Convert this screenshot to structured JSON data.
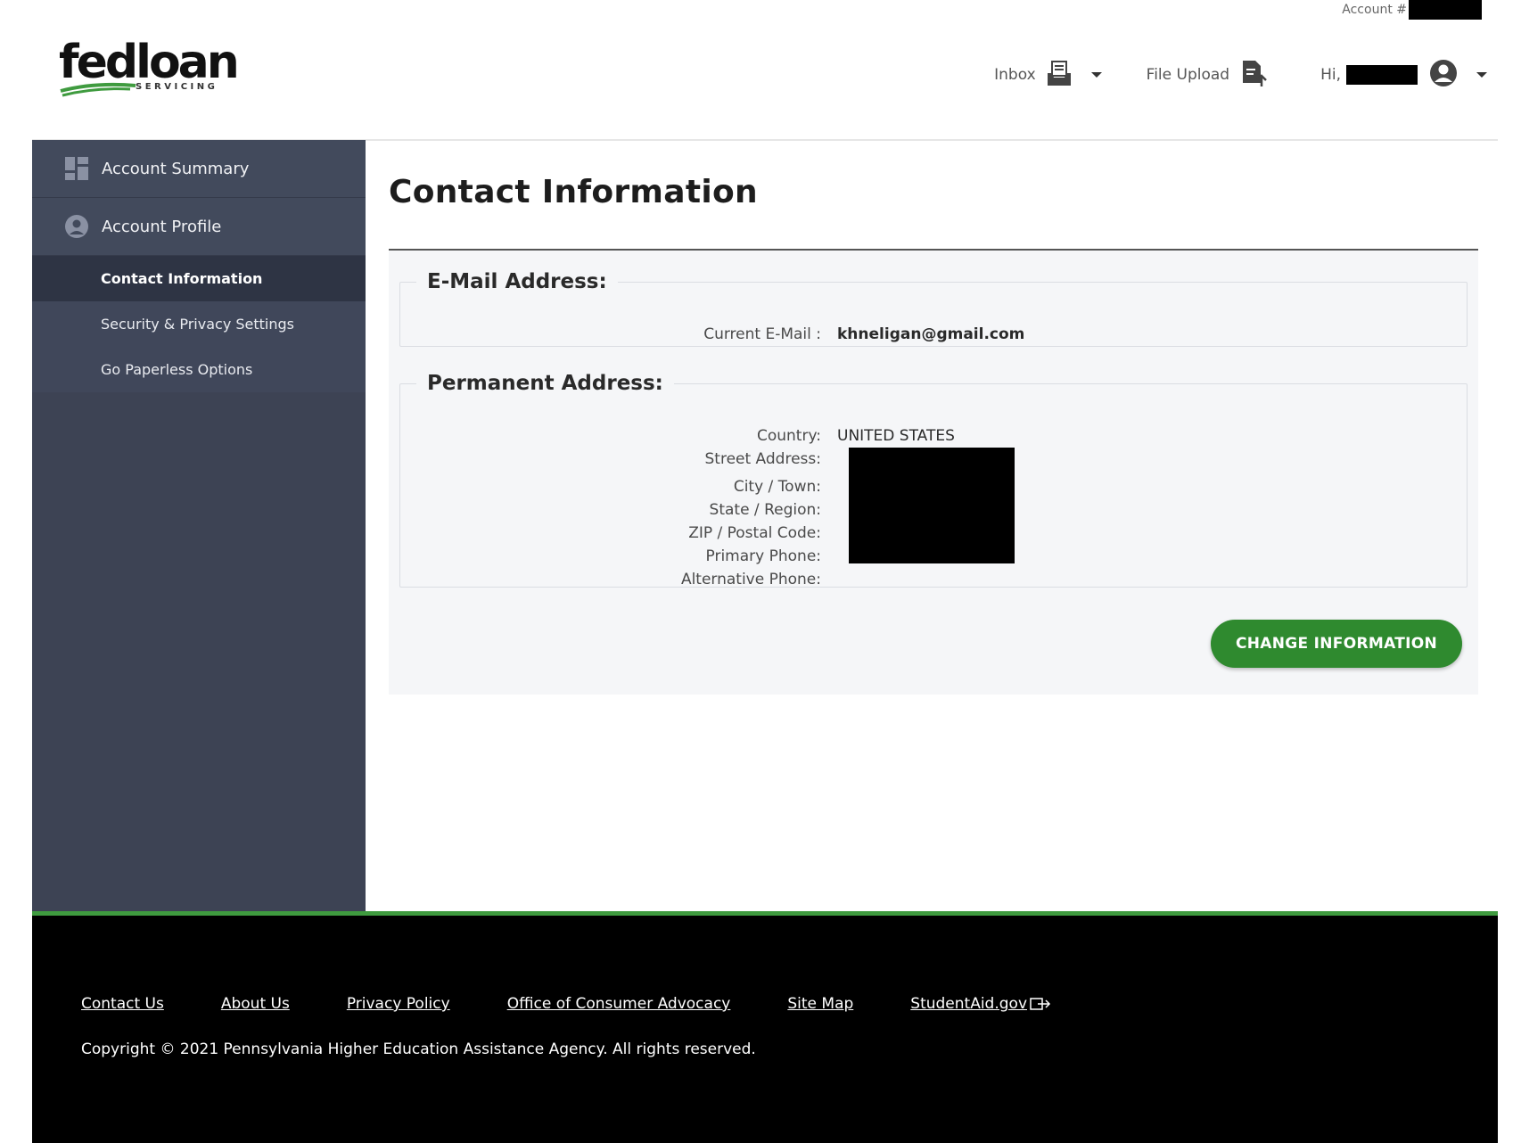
{
  "header": {
    "account_label": "Account #",
    "logo_text": "fedloan",
    "logo_sub": "SERVICING",
    "inbox_label": "Inbox",
    "file_upload_label": "File Upload",
    "greeting": "Hi,"
  },
  "sidebar": {
    "items": [
      {
        "label": "Account Summary",
        "icon": "dashboard-icon"
      },
      {
        "label": "Account Profile",
        "icon": "user-circle-icon"
      }
    ],
    "subitems": [
      {
        "label": "Contact Information",
        "active": true
      },
      {
        "label": "Security & Privacy Settings",
        "active": false
      },
      {
        "label": "Go Paperless Options",
        "active": false
      }
    ]
  },
  "main": {
    "title": "Contact Information",
    "email_section": {
      "legend": "E-Mail Address:",
      "current_label": "Current E-Mail :",
      "current_value": "khneligan@gmail.com"
    },
    "address_section": {
      "legend": "Permanent Address:",
      "country_label": "Country:",
      "country_value": "UNITED STATES",
      "street_label": "Street Address:",
      "city_label": "City / Town:",
      "state_label": "State / Region:",
      "zip_label": "ZIP / Postal Code:",
      "primary_phone_label": "Primary Phone:",
      "alt_phone_label": "Alternative Phone:"
    },
    "change_button": "CHANGE INFORMATION"
  },
  "footer": {
    "links": [
      "Contact Us",
      "About Us",
      "Privacy Policy",
      "Office of Consumer Advocacy",
      "Site Map",
      "StudentAid.gov"
    ],
    "copyright": "Copyright © 2021 Pennsylvania Higher Education Assistance Agency. All rights reserved."
  },
  "colors": {
    "sidebar_bg": "#3d4354",
    "sidebar_active": "#2e3444",
    "brand_green": "#2f8a2f",
    "footer_bg": "#000000"
  }
}
